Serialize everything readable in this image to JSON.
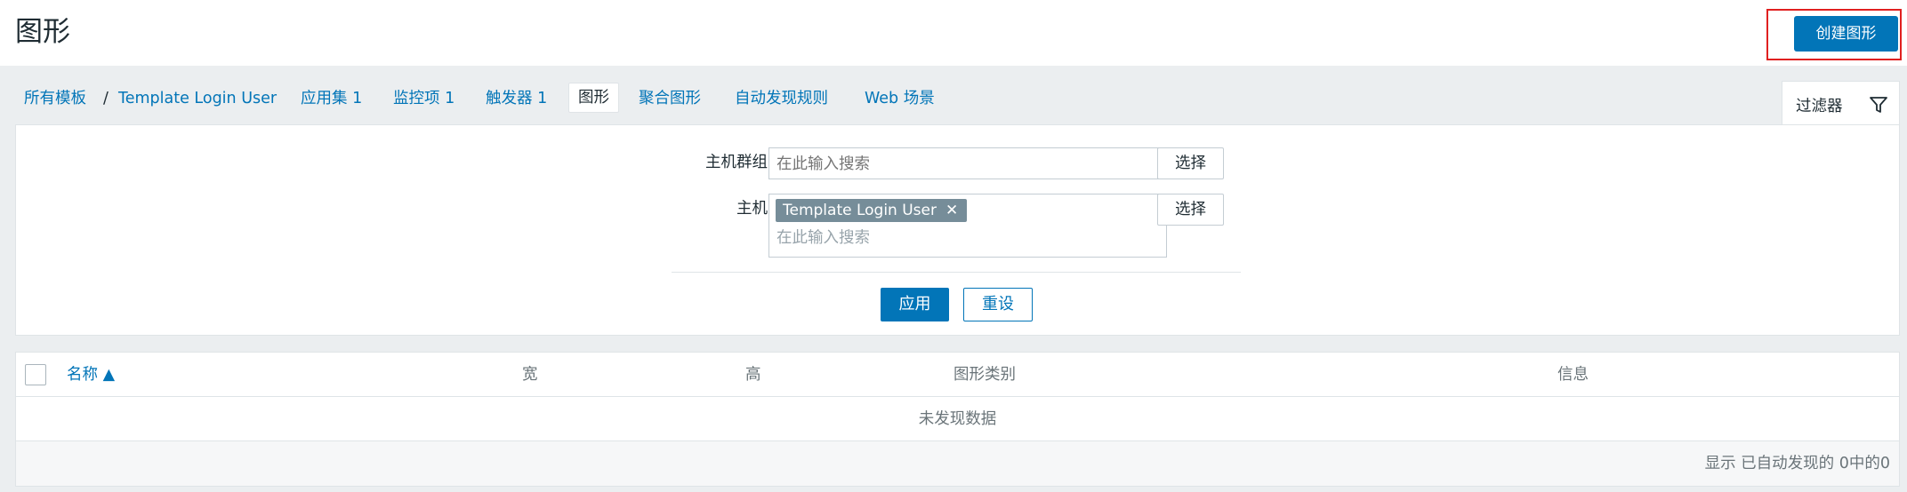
{
  "header": {
    "title": "图形",
    "create_button": "创建图形"
  },
  "nav": {
    "breadcrumb_root": "所有模板",
    "separator": "/",
    "template": "Template Login User",
    "tabs": [
      {
        "label": "应用集 1"
      },
      {
        "label": "监控项 1"
      },
      {
        "label": "触发器 1"
      },
      {
        "label": "图形",
        "active": true
      },
      {
        "label": "聚合图形"
      },
      {
        "label": "自动发现规则"
      },
      {
        "label": "Web 场景"
      }
    ],
    "filter_tab": "过滤器",
    "filter_icon": "funnel-icon"
  },
  "filter": {
    "host_group_label": "主机群组",
    "host_group_placeholder": "在此输入搜索",
    "host_label": "主机",
    "host_chip": "Template Login User",
    "host_chip_remove": "✕",
    "host_placeholder": "在此输入搜索",
    "select_label": "选择",
    "apply_label": "应用",
    "reset_label": "重设"
  },
  "table": {
    "columns": [
      "名称 ▲",
      "宽",
      "高",
      "图形类别",
      "信息"
    ],
    "empty_text": "未发现数据",
    "footer": "显示 已自动发现的 0中的0"
  },
  "colors": {
    "accent": "#0275b8",
    "highlight_border": "#e02020",
    "chip_bg": "#768d99"
  }
}
